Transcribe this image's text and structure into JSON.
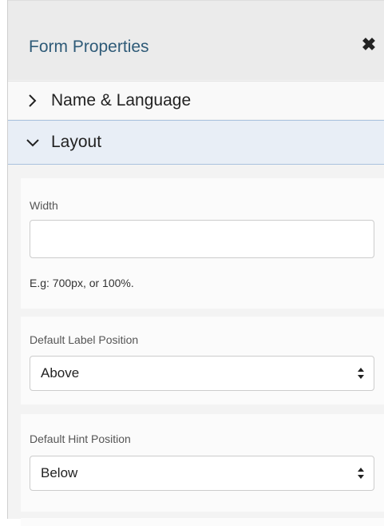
{
  "panel": {
    "title": "Form Properties",
    "close_icon": "close-icon"
  },
  "sections": {
    "name_language": {
      "label": "Name & Language",
      "expanded": false
    },
    "layout": {
      "label": "Layout",
      "expanded": true
    }
  },
  "layout": {
    "width": {
      "label": "Width",
      "value": "",
      "placeholder": "",
      "hint": "E.g: 700px, or 100%."
    },
    "label_position": {
      "label": "Default Label Position",
      "selected": "Above"
    },
    "hint_position": {
      "label": "Default Hint Position",
      "selected": "Below"
    }
  },
  "colors": {
    "title": "#2f5b78",
    "active_section_bg": "#e8eef6",
    "active_section_border": "#a9c2de"
  }
}
